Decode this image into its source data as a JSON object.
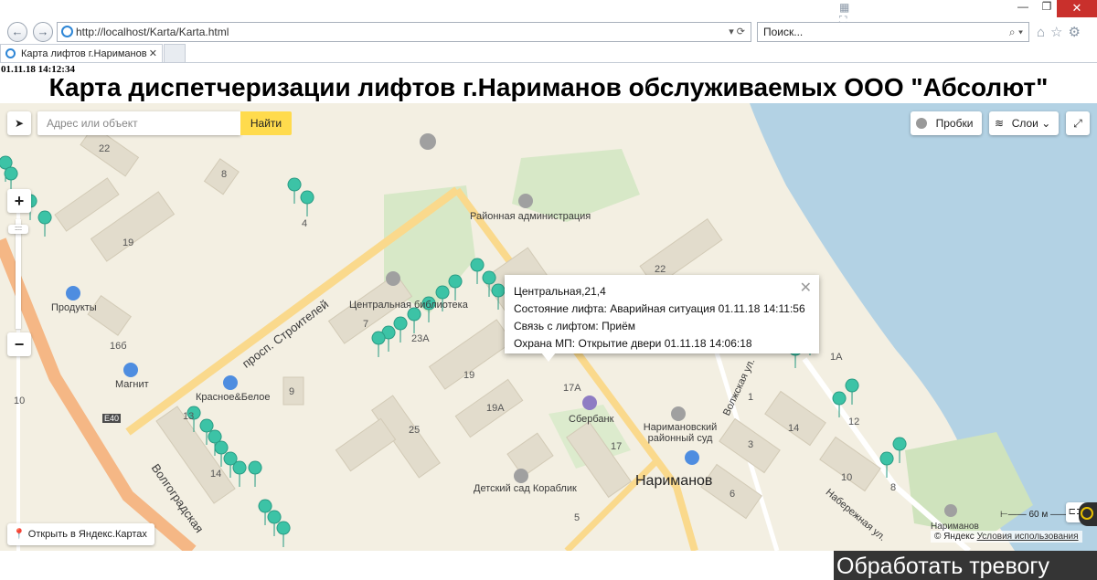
{
  "browser": {
    "url": "http://localhost/Karta/Karta.html",
    "search_placeholder": "Поиск...",
    "tab_title": "Карта лифтов г.Нариманов",
    "tab_close": "✕",
    "min_label": "—",
    "max_label": "❐",
    "close_label": "✕"
  },
  "header": {
    "timestamp": "01.11.18 14:12:34",
    "title": "Карта диспетчеризации лифтов г.Нариманов обслуживаемых ООО \"Абсолют\""
  },
  "map": {
    "search_placeholder": "Адрес или объект",
    "find_label": "Найти",
    "traffic_label": "Пробки",
    "layers_label": "Слои",
    "open_yandex_label": "Открыть в Яндекс.Картах",
    "scale_label": "60 м",
    "copyright_prefix": "© Яндекс",
    "terms_label": "Условия использования",
    "labels": {
      "admin": "Районная администрация",
      "library": "Центральная библиотека",
      "products": "Продукты",
      "magnit": "Магнит",
      "krasnoe": "Красное&Белое",
      "sberbank": "Сбербанк",
      "court": "Наримановский районный суд",
      "kindergarten": "Детский сад Кораблик",
      "city": "Нариманов",
      "street_builders": "просп. Строителей",
      "street_volgograd": "Волгоградская",
      "street_volzhskaya": "Волжская ул.",
      "street_embankment": "Набережная ул.",
      "road_e40": "E40",
      "narimanov_small": "Нариманов"
    },
    "house_numbers": [
      "22",
      "8",
      "4",
      "19",
      "7",
      "23А",
      "16б",
      "10",
      "9",
      "13",
      "14",
      "19",
      "19А",
      "25",
      "22",
      "17А",
      "17",
      "1",
      "14",
      "12",
      "10",
      "3",
      "6",
      "8",
      "1А",
      "5"
    ]
  },
  "popup": {
    "address": "Центральная,21,4",
    "state_label": "Состояние лифта:",
    "state_value": "Аварийная ситуация 01.11.18 14:11:56",
    "link_label": "Связь с лифтом:",
    "link_value": "Приём",
    "guard_label": "Охрана МП:",
    "guard_value": "Открытие двери 01.11.18 14:06:18",
    "close": "✕"
  },
  "alarm_button": "Обработать тревогу",
  "colors": {
    "marker": "#3cc3a6",
    "find": "#ffdb4d",
    "water": "#b3d2e4",
    "alarm_bg": "#353535"
  }
}
